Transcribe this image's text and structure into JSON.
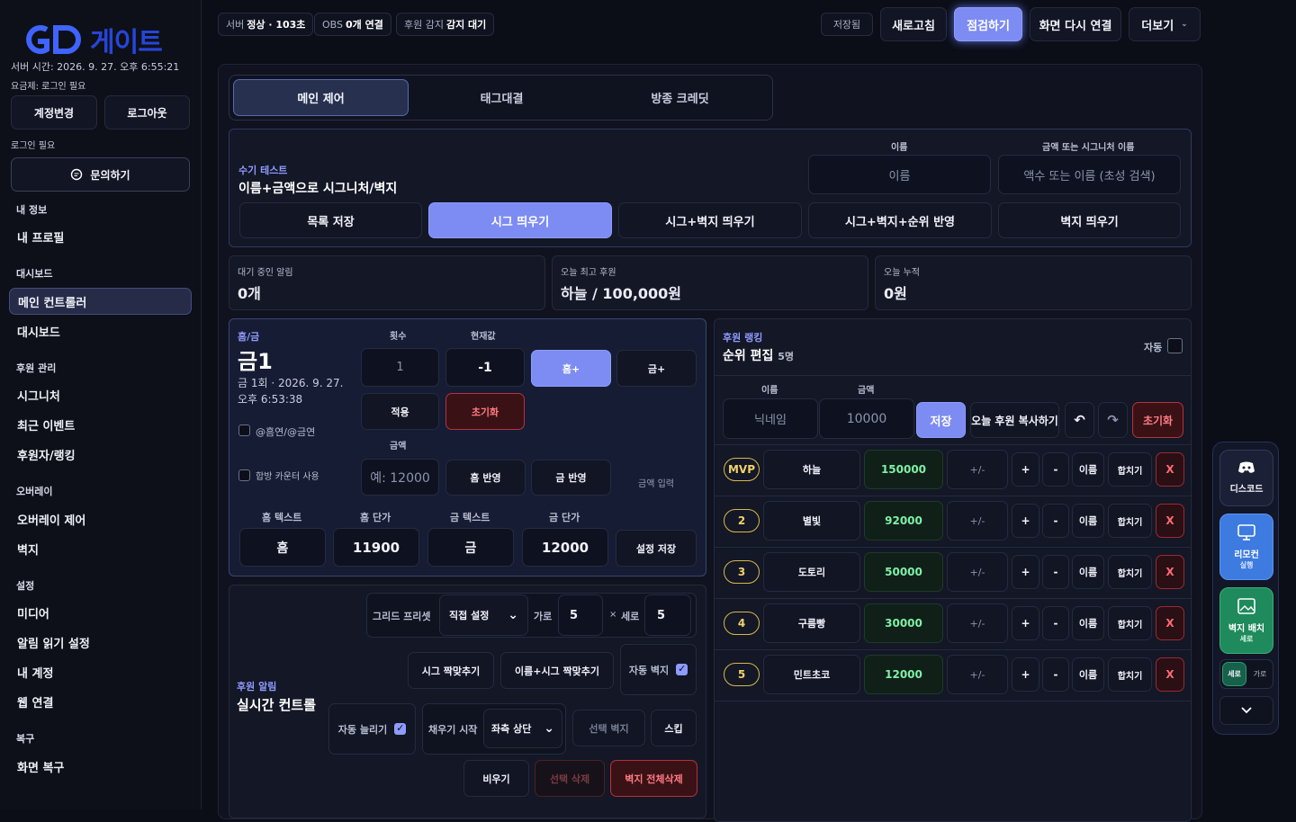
{
  "sidebar": {
    "logo_text": "게이트",
    "server_time": "서버 시간: 2026. 9. 27. 오후 6:55:21",
    "plan": "요금제: 로그인 필요",
    "switch_account": "계정변경",
    "logout": "로그아웃",
    "login_required": "로그인 필요",
    "inquiry": "문의하기",
    "sections": {
      "my_info": "내 정보",
      "profile": "내 프로필",
      "dashboard": "대시보드",
      "main_controller": "메인 컨트롤러",
      "dashboard_item": "대시보드",
      "donation_mgmt": "후원 관리",
      "signature": "시그니처",
      "recent_events": "최근 이벤트",
      "donors_ranking": "후원자/랭킹",
      "overlay": "오버레이",
      "overlay_control": "오버레이 제어",
      "wall": "벽지",
      "settings": "설정",
      "media": "미디어",
      "alert_reading": "알림 읽기 설정",
      "my_account": "내 계정",
      "web_connect": "웹 연결",
      "restore": "복구",
      "screen_restore": "화면 복구"
    }
  },
  "topbar": {
    "server_label": "서버",
    "server_value": "정상 · 103초",
    "obs_label": "OBS",
    "obs_value": "0개 연결",
    "detect_label": "후원 감지",
    "detect_value": "감지 대기",
    "saved": "저장됨",
    "refresh": "새로고침",
    "inspect": "점검하기",
    "reconnect": "화면 다시 연결",
    "more": "더보기"
  },
  "tabs": [
    "메인 제어",
    "태그대결",
    "방종 크레딧"
  ],
  "manual_test": {
    "kicker": "수기 테스트",
    "title": "이름+금액으로 시그니처/벽지",
    "name_label": "이름",
    "name_placeholder": "이름",
    "amount_label": "금액 또는 시그니처 이름",
    "amount_placeholder": "액수 또는 이름 (초성 검색)",
    "buttons": [
      "목록 저장",
      "시그 띄우기",
      "시그+벽지 띄우기",
      "시그+벽지+순위 반영",
      "벽지 띄우기"
    ]
  },
  "stats": {
    "pending_label": "대기 중인 알림",
    "pending_value": "0개",
    "top_label": "오늘 최고 후원",
    "top_value": "하늘 / 100,000원",
    "total_label": "오늘 누적",
    "total_value": "0원"
  },
  "heum": {
    "kicker": "흠/금",
    "title": "금1",
    "meta": "금 1회 · 2026. 9. 27. 오후 6:53:38",
    "count_label": "횟수",
    "count_value": "1",
    "current_label": "현재값",
    "current_value": "-1",
    "heum_plus": "흠+",
    "geum_plus": "금+",
    "apply": "적용",
    "reset": "초기화",
    "nick_check": "@흠연/@금연",
    "combined_check": "합방 카운터 사용",
    "amount_label": "금액",
    "amount_placeholder": "예: 12000",
    "heum_reflect": "흠 반영",
    "geum_reflect": "금 반영",
    "amount_input": "금액 입력",
    "heum_text_label": "흠 텍스트",
    "heum_price_label": "흠 단가",
    "geum_text_label": "금 텍스트",
    "geum_price_label": "금 단가",
    "heum_text": "흠",
    "heum_price": "11900",
    "geum_text": "금",
    "geum_price": "12000",
    "save_settings": "설정 저장"
  },
  "realtime": {
    "kicker": "후원 알림",
    "title": "실시간 컨트롤",
    "grid_preset": "그리드 프리셋",
    "grid_select": "직접 설정",
    "width_label": "가로",
    "width_value": "5",
    "x": "×",
    "height_label": "세로",
    "height_value": "5",
    "sig_match": "시그 짝맞추기",
    "name_sig_match": "이름+시그 짝맞추기",
    "auto_wall": "자동 벽지",
    "auto_grow": "자동 늘리기",
    "fill_start": "채우기 시작",
    "fill_select": "좌측 상단",
    "select_wall": "선택 벽지",
    "skip": "스킵",
    "clear": "비우기",
    "delete_selected": "선택 삭제",
    "delete_all": "벽지 전체삭제"
  },
  "ranking": {
    "kicker": "후원 랭킹",
    "title": "순위 편집",
    "count": "5명",
    "auto": "자동",
    "name_label": "이름",
    "amount_label": "금액",
    "nick_placeholder": "닉네임",
    "amount_placeholder": "10000",
    "save": "저장",
    "copy_today": "오늘 후원 복사하기",
    "undo": "↶",
    "redo": "↷",
    "reset": "초기화",
    "pm": "+/-",
    "plus": "+",
    "minus": "-",
    "name_btn": "이름",
    "combine": "합치기",
    "x": "X",
    "rows": [
      {
        "rank": "MVP",
        "name": "하늘",
        "amount": "150000"
      },
      {
        "rank": "2",
        "name": "별빛",
        "amount": "92000"
      },
      {
        "rank": "3",
        "name": "도토리",
        "amount": "50000"
      },
      {
        "rank": "4",
        "name": "구름빵",
        "amount": "30000"
      },
      {
        "rank": "5",
        "name": "민트초코",
        "amount": "12000"
      }
    ]
  },
  "rail": {
    "discord": "디스코드",
    "remote": "리모컨",
    "remote_sub": "실행",
    "wall_layout": "벽지 배치",
    "wall_sub": "세로",
    "vertical": "세로",
    "horizontal": "가로"
  }
}
